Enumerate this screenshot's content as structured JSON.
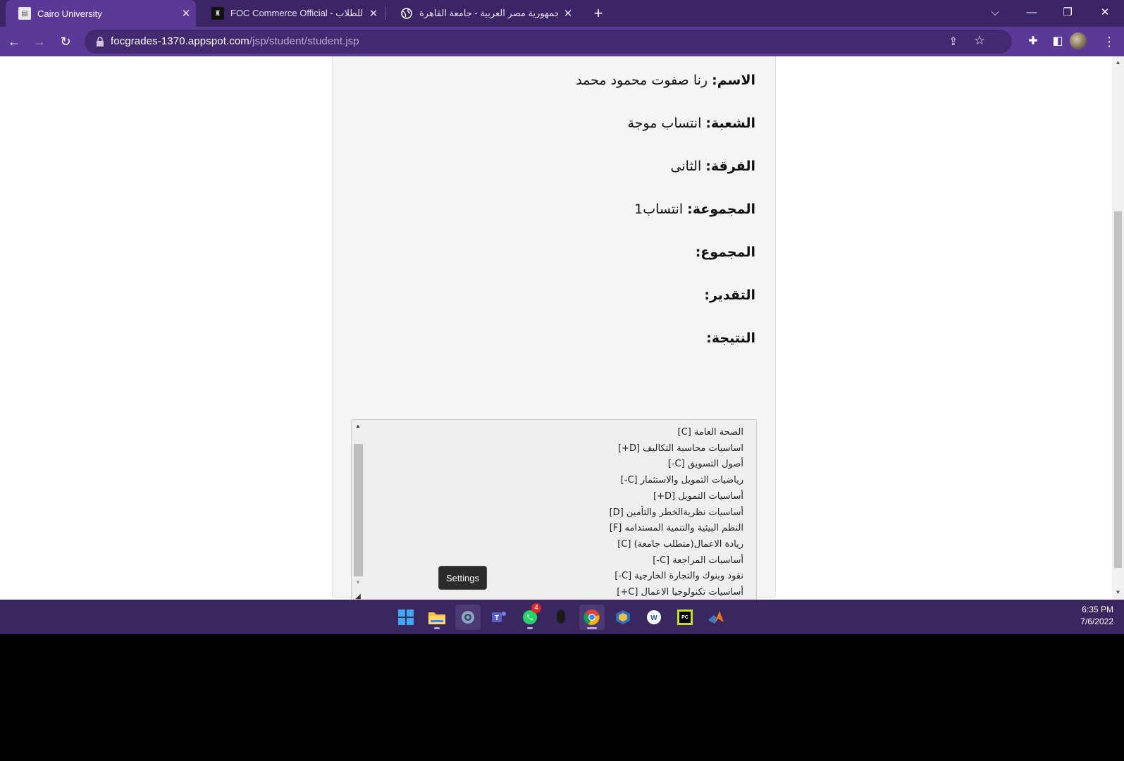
{
  "browser": {
    "tabs": [
      {
        "title": "Cairo University",
        "active": true
      },
      {
        "title": "FOC Commerce Official - ى للطلاب",
        "active": false
      },
      {
        "title": "جمهورية مصر العربية - جامعة القاهرة",
        "active": false
      }
    ],
    "url_host": "focgrades-1370.appspot.com",
    "url_path": "/jsp/student/student.jsp"
  },
  "student": {
    "name_label": "الاسم:",
    "name_value": " رنا صفوت محمود محمد",
    "division_label": "الشعبة:",
    "division_value": " انتساب موجة",
    "year_label": "الفرقة:",
    "year_value": " الثانى",
    "group_label": "المجموعة:",
    "group_value": " انتساب1",
    "total_label": "المجموع:",
    "grade_label": "التقدير:",
    "result_label": "النتيجة:"
  },
  "results": [
    "الصحة العامة [C]",
    "اساسيات محاسبة التكاليف [D+]",
    "أصول التسويق [C-]",
    "رياضيات التمويل والاستثمار [C-]",
    "أساسيات التمويل [D+]",
    "أساسيات نظريةالخطر والتأمين [D]",
    "النظم البيئية والتنمية المستدامه [F]",
    "ريادة الاعمال(متطلب جامعة) [C]",
    "أساسيات المراجعة [C-]",
    "نقود وبنوك والتجارة الخارجية [C-]",
    "أساسيات تكنولوجيا الاعمال [C+]"
  ],
  "tooltip": "Settings",
  "taskbar": {
    "whatsapp_badge": "4",
    "time": "6:35 PM",
    "date": "7/6/2022"
  }
}
